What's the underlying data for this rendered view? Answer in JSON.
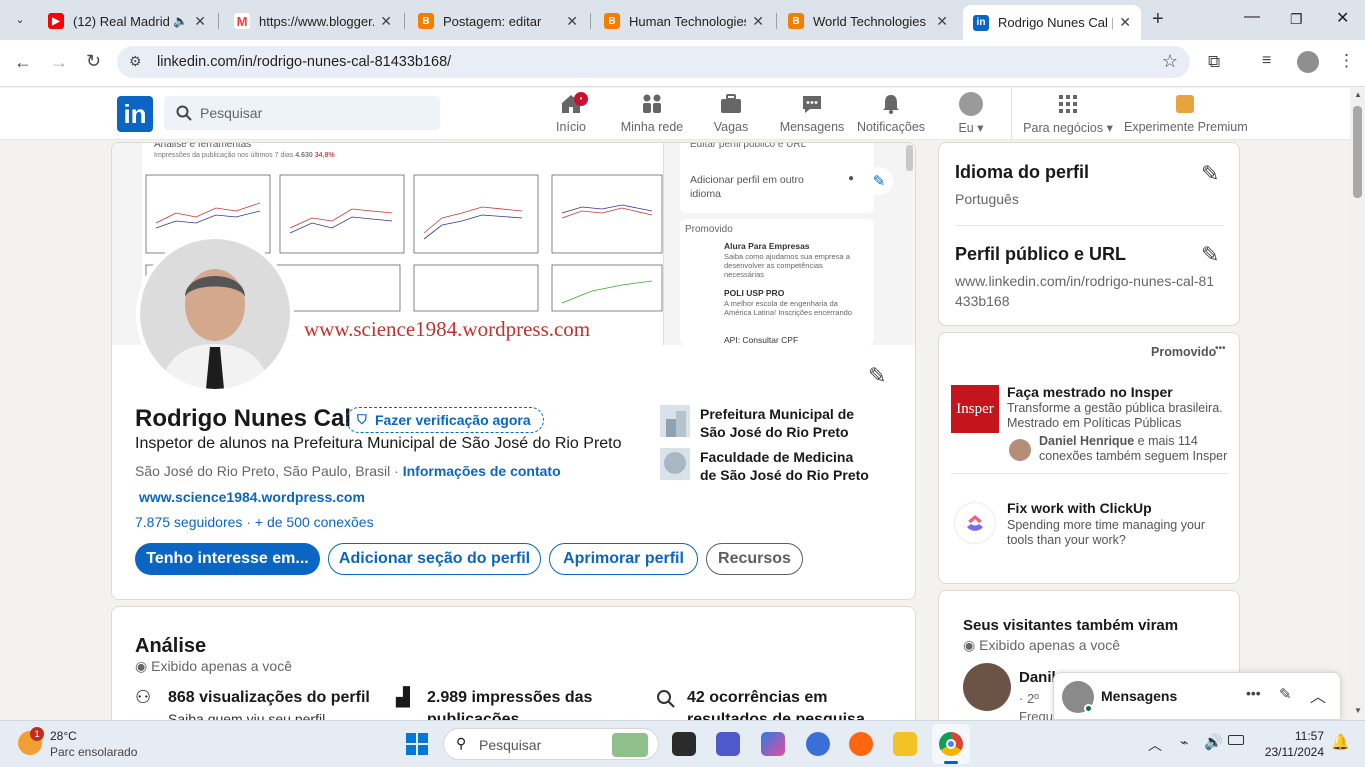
{
  "browser": {
    "tabs": [
      {
        "title": "(12) Real Madrid S",
        "icon": "youtube-icon",
        "color": "#ff0000"
      },
      {
        "title": "https://www.blogger.c",
        "icon": "gmail-icon",
        "color": "#ea4335"
      },
      {
        "title": "Postagem: editar",
        "icon": "blogger-icon",
        "color": "#f57d00"
      },
      {
        "title": "Human Technologies",
        "icon": "blogger-icon",
        "color": "#f57d00"
      },
      {
        "title": "World Technologies -",
        "icon": "blogger-icon",
        "color": "#f57d00"
      },
      {
        "title": "Rodrigo Nunes Cal | L",
        "icon": "linkedin-icon",
        "color": "#0a66c2"
      }
    ],
    "url": "linkedin.com/in/rodrigo-nunes-cal-81433b168/"
  },
  "nav": {
    "search_placeholder": "Pesquisar",
    "items": [
      "Início",
      "Minha rede",
      "Vagas",
      "Mensagens",
      "Notificações",
      "Eu",
      "Para negócios",
      "Experimente Premium"
    ],
    "badge": "•"
  },
  "profile": {
    "cover_url_text": "www.science1984.wordpress.com",
    "cover_side": {
      "edit": "Editar perfil público e URL",
      "add": "Adicionar perfil em outro idioma",
      "promoted": "Promovido",
      "ad1": "Alura Para Empresas",
      "ad1_sub": "Saiba como ajudamos sua empresa a desenvolver as competências necessárias",
      "ad2": "POLI USP PRO",
      "ad2_sub": "A melhor escola de engenharia da América Latina! Inscrições encerrando",
      "ad3": "API: Consultar CPF",
      "cover_chart_title": "Análise e ferramentas",
      "cover_chart_sub": "Impressões da publicação nos últimos 7 dias",
      "cover_chart_num": "4.630",
      "cover_chart_pct": "34,8%"
    },
    "name": "Rodrigo Nunes Cal",
    "verify": "Fazer verificação agora",
    "headline": "Inspetor de alunos na Prefeitura Municipal de São José do Rio Preto",
    "location": "São José do Rio Preto, São Paulo, Brasil",
    "dot": "·",
    "contact": "Informações de contato",
    "website": "www.science1984.wordpress.com",
    "followers": "7.875 seguidores",
    "connections": "+ de 500 conexões",
    "orgs": [
      "Prefeitura Municipal de São José do Rio Preto",
      "Faculdade de Medicina de São José do Rio Preto"
    ],
    "buttons": [
      "Tenho interesse em...",
      "Adicionar seção do perfil",
      "Aprimorar perfil",
      "Recursos"
    ]
  },
  "analysis": {
    "title": "Análise",
    "private": "Exibido apenas a você",
    "stats": [
      {
        "main": "868 visualizações do perfil",
        "sub": "Saiba quem viu seu perfil"
      },
      {
        "main": "2.989 impressões das",
        "sub": "publicações"
      },
      {
        "main": "42 ocorrências em",
        "sub": "resultados de pesquisa"
      }
    ]
  },
  "sidebar": {
    "lang_title": "Idioma do perfil",
    "lang_value": "Português",
    "url_title": "Perfil público e URL",
    "url_value": "www.linkedin.com/in/rodrigo-nunes-cal-81433b168",
    "promoted": "Promovido",
    "more": "•••",
    "ads": [
      {
        "title": "Faça mestrado no Insper",
        "desc": "Transforme a gestão pública brasileira. Mestrado em Políticas Públicas",
        "social_name": "Daniel Henrique",
        "social_rest": " e mais 114 conexões também seguem Insper",
        "logo": "Insper"
      },
      {
        "title": "Fix work with ClickUp",
        "desc": "Spending more time managing your tools than your work?"
      }
    ],
    "viewers_title": "Seus visitantes também viram",
    "viewers_private": "Exibido apenas a você",
    "viewer_name": "Danil",
    "viewer_degree": "· 2º",
    "viewer_sub": "Frequ"
  },
  "messaging": {
    "title": "Mensagens"
  },
  "taskbar": {
    "weather_temp": "28°C",
    "weather_desc": "Parc ensolarado",
    "weather_badge": "1",
    "search": "Pesquisar",
    "time": "11:57",
    "date": "23/11/2024"
  }
}
